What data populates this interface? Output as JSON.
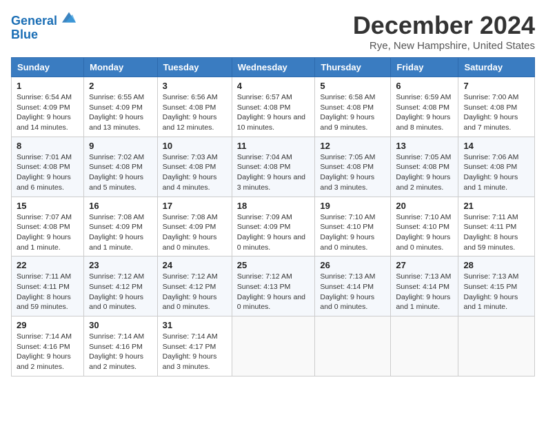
{
  "logo": {
    "line1": "General",
    "line2": "Blue"
  },
  "header": {
    "month": "December 2024",
    "location": "Rye, New Hampshire, United States"
  },
  "weekdays": [
    "Sunday",
    "Monday",
    "Tuesday",
    "Wednesday",
    "Thursday",
    "Friday",
    "Saturday"
  ],
  "weeks": [
    [
      {
        "day": "1",
        "sunrise": "Sunrise: 6:54 AM",
        "sunset": "Sunset: 4:09 PM",
        "daylight": "Daylight: 9 hours and 14 minutes."
      },
      {
        "day": "2",
        "sunrise": "Sunrise: 6:55 AM",
        "sunset": "Sunset: 4:09 PM",
        "daylight": "Daylight: 9 hours and 13 minutes."
      },
      {
        "day": "3",
        "sunrise": "Sunrise: 6:56 AM",
        "sunset": "Sunset: 4:08 PM",
        "daylight": "Daylight: 9 hours and 12 minutes."
      },
      {
        "day": "4",
        "sunrise": "Sunrise: 6:57 AM",
        "sunset": "Sunset: 4:08 PM",
        "daylight": "Daylight: 9 hours and 10 minutes."
      },
      {
        "day": "5",
        "sunrise": "Sunrise: 6:58 AM",
        "sunset": "Sunset: 4:08 PM",
        "daylight": "Daylight: 9 hours and 9 minutes."
      },
      {
        "day": "6",
        "sunrise": "Sunrise: 6:59 AM",
        "sunset": "Sunset: 4:08 PM",
        "daylight": "Daylight: 9 hours and 8 minutes."
      },
      {
        "day": "7",
        "sunrise": "Sunrise: 7:00 AM",
        "sunset": "Sunset: 4:08 PM",
        "daylight": "Daylight: 9 hours and 7 minutes."
      }
    ],
    [
      {
        "day": "8",
        "sunrise": "Sunrise: 7:01 AM",
        "sunset": "Sunset: 4:08 PM",
        "daylight": "Daylight: 9 hours and 6 minutes."
      },
      {
        "day": "9",
        "sunrise": "Sunrise: 7:02 AM",
        "sunset": "Sunset: 4:08 PM",
        "daylight": "Daylight: 9 hours and 5 minutes."
      },
      {
        "day": "10",
        "sunrise": "Sunrise: 7:03 AM",
        "sunset": "Sunset: 4:08 PM",
        "daylight": "Daylight: 9 hours and 4 minutes."
      },
      {
        "day": "11",
        "sunrise": "Sunrise: 7:04 AM",
        "sunset": "Sunset: 4:08 PM",
        "daylight": "Daylight: 9 hours and 3 minutes."
      },
      {
        "day": "12",
        "sunrise": "Sunrise: 7:05 AM",
        "sunset": "Sunset: 4:08 PM",
        "daylight": "Daylight: 9 hours and 3 minutes."
      },
      {
        "day": "13",
        "sunrise": "Sunrise: 7:05 AM",
        "sunset": "Sunset: 4:08 PM",
        "daylight": "Daylight: 9 hours and 2 minutes."
      },
      {
        "day": "14",
        "sunrise": "Sunrise: 7:06 AM",
        "sunset": "Sunset: 4:08 PM",
        "daylight": "Daylight: 9 hours and 1 minute."
      }
    ],
    [
      {
        "day": "15",
        "sunrise": "Sunrise: 7:07 AM",
        "sunset": "Sunset: 4:08 PM",
        "daylight": "Daylight: 9 hours and 1 minute."
      },
      {
        "day": "16",
        "sunrise": "Sunrise: 7:08 AM",
        "sunset": "Sunset: 4:09 PM",
        "daylight": "Daylight: 9 hours and 1 minute."
      },
      {
        "day": "17",
        "sunrise": "Sunrise: 7:08 AM",
        "sunset": "Sunset: 4:09 PM",
        "daylight": "Daylight: 9 hours and 0 minutes."
      },
      {
        "day": "18",
        "sunrise": "Sunrise: 7:09 AM",
        "sunset": "Sunset: 4:09 PM",
        "daylight": "Daylight: 9 hours and 0 minutes."
      },
      {
        "day": "19",
        "sunrise": "Sunrise: 7:10 AM",
        "sunset": "Sunset: 4:10 PM",
        "daylight": "Daylight: 9 hours and 0 minutes."
      },
      {
        "day": "20",
        "sunrise": "Sunrise: 7:10 AM",
        "sunset": "Sunset: 4:10 PM",
        "daylight": "Daylight: 9 hours and 0 minutes."
      },
      {
        "day": "21",
        "sunrise": "Sunrise: 7:11 AM",
        "sunset": "Sunset: 4:11 PM",
        "daylight": "Daylight: 8 hours and 59 minutes."
      }
    ],
    [
      {
        "day": "22",
        "sunrise": "Sunrise: 7:11 AM",
        "sunset": "Sunset: 4:11 PM",
        "daylight": "Daylight: 8 hours and 59 minutes."
      },
      {
        "day": "23",
        "sunrise": "Sunrise: 7:12 AM",
        "sunset": "Sunset: 4:12 PM",
        "daylight": "Daylight: 9 hours and 0 minutes."
      },
      {
        "day": "24",
        "sunrise": "Sunrise: 7:12 AM",
        "sunset": "Sunset: 4:12 PM",
        "daylight": "Daylight: 9 hours and 0 minutes."
      },
      {
        "day": "25",
        "sunrise": "Sunrise: 7:12 AM",
        "sunset": "Sunset: 4:13 PM",
        "daylight": "Daylight: 9 hours and 0 minutes."
      },
      {
        "day": "26",
        "sunrise": "Sunrise: 7:13 AM",
        "sunset": "Sunset: 4:14 PM",
        "daylight": "Daylight: 9 hours and 0 minutes."
      },
      {
        "day": "27",
        "sunrise": "Sunrise: 7:13 AM",
        "sunset": "Sunset: 4:14 PM",
        "daylight": "Daylight: 9 hours and 1 minute."
      },
      {
        "day": "28",
        "sunrise": "Sunrise: 7:13 AM",
        "sunset": "Sunset: 4:15 PM",
        "daylight": "Daylight: 9 hours and 1 minute."
      }
    ],
    [
      {
        "day": "29",
        "sunrise": "Sunrise: 7:14 AM",
        "sunset": "Sunset: 4:16 PM",
        "daylight": "Daylight: 9 hours and 2 minutes."
      },
      {
        "day": "30",
        "sunrise": "Sunrise: 7:14 AM",
        "sunset": "Sunset: 4:16 PM",
        "daylight": "Daylight: 9 hours and 2 minutes."
      },
      {
        "day": "31",
        "sunrise": "Sunrise: 7:14 AM",
        "sunset": "Sunset: 4:17 PM",
        "daylight": "Daylight: 9 hours and 3 minutes."
      },
      null,
      null,
      null,
      null
    ]
  ]
}
